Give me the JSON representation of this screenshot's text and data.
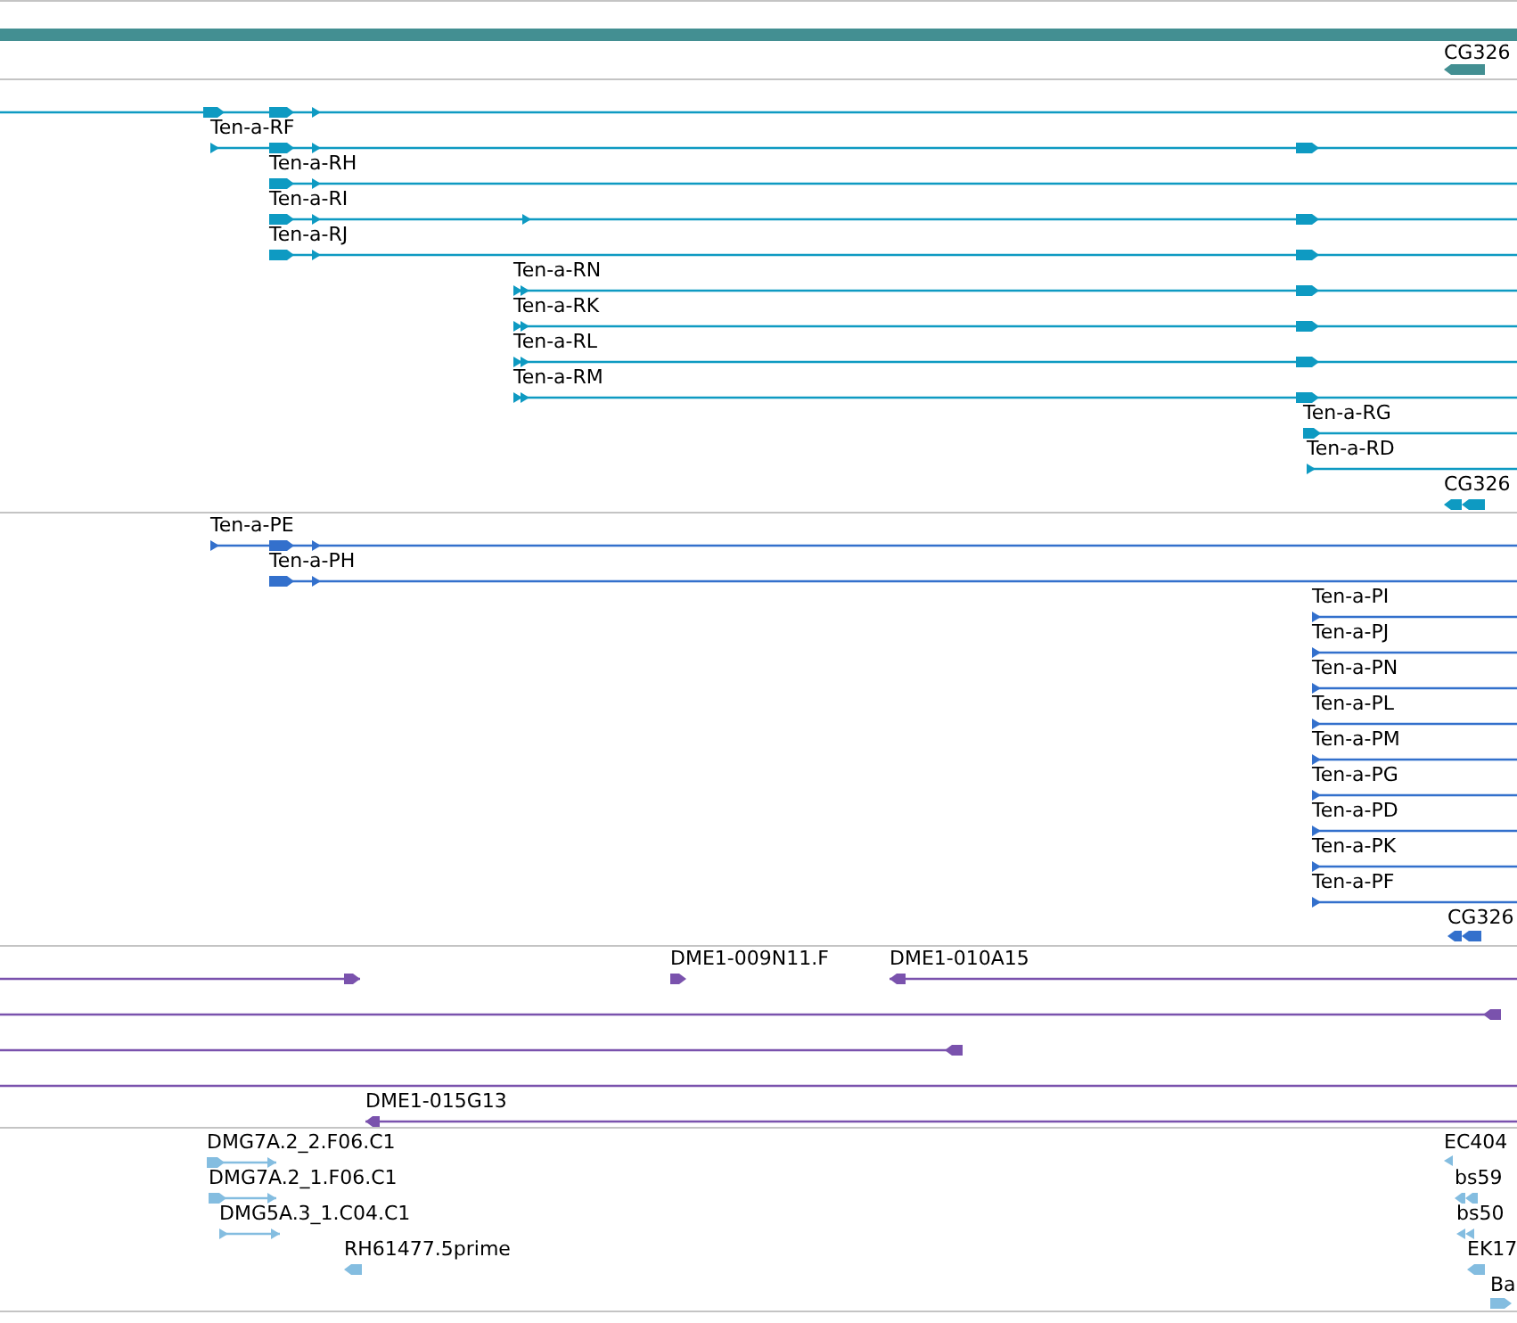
{
  "tracks": [
    {
      "color": "#438f92",
      "features": [
        {
          "label": "CG326"
        }
      ]
    },
    {
      "color": "#0e9ac2",
      "features": [
        {
          "label": "Ten-a-RF"
        },
        {
          "label": "Ten-a-RH"
        },
        {
          "label": "Ten-a-RI"
        },
        {
          "label": "Ten-a-RJ"
        },
        {
          "label": "Ten-a-RN"
        },
        {
          "label": "Ten-a-RK"
        },
        {
          "label": "Ten-a-RL"
        },
        {
          "label": "Ten-a-RM"
        },
        {
          "label": "Ten-a-RG"
        },
        {
          "label": "Ten-a-RD"
        },
        {
          "label": "CG326"
        }
      ]
    },
    {
      "color": "#3370cc",
      "features": [
        {
          "label": "Ten-a-PE"
        },
        {
          "label": "Ten-a-PH"
        },
        {
          "label": "Ten-a-PI"
        },
        {
          "label": "Ten-a-PJ"
        },
        {
          "label": "Ten-a-PN"
        },
        {
          "label": "Ten-a-PL"
        },
        {
          "label": "Ten-a-PM"
        },
        {
          "label": "Ten-a-PG"
        },
        {
          "label": "Ten-a-PD"
        },
        {
          "label": "Ten-a-PK"
        },
        {
          "label": "Ten-a-PF"
        },
        {
          "label": "CG326"
        }
      ]
    },
    {
      "color": "#7a52ad",
      "features": [
        {
          "label": "DME1-009N11.F"
        },
        {
          "label": "DME1-010A15"
        },
        {
          "label": "DME1-015G13"
        }
      ]
    },
    {
      "color": "#84bde0",
      "features": [
        {
          "label": "DMG7A.2_2.F06.C1"
        },
        {
          "label": "DMG7A.2_1.F06.C1"
        },
        {
          "label": "DMG5A.3_1.C04.C1"
        },
        {
          "label": "RH61477.5prime"
        },
        {
          "label": "EC404"
        },
        {
          "label": "bs59"
        },
        {
          "label": "bs50"
        },
        {
          "label": "EK17"
        },
        {
          "label": "Ba"
        }
      ]
    }
  ]
}
